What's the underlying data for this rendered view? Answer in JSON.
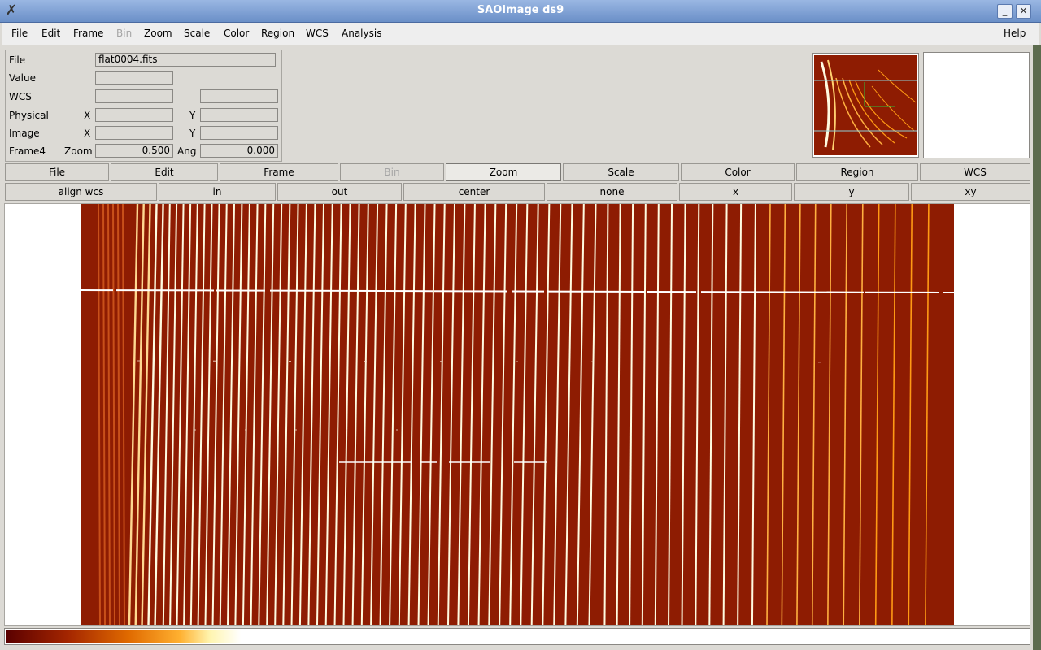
{
  "window": {
    "title": "SAOImage ds9",
    "minimize_glyph": "_",
    "close_glyph": "✕"
  },
  "menubar": {
    "items": [
      {
        "label": "File"
      },
      {
        "label": "Edit"
      },
      {
        "label": "Frame"
      },
      {
        "label": "Bin",
        "disabled": true
      },
      {
        "label": "Zoom"
      },
      {
        "label": "Scale"
      },
      {
        "label": "Color"
      },
      {
        "label": "Region"
      },
      {
        "label": "WCS"
      },
      {
        "label": "Analysis"
      }
    ],
    "help": "Help"
  },
  "info": {
    "file_label": "File",
    "file_value": "flat0004.fits",
    "value_label": "Value",
    "value": "",
    "wcs_label": "WCS",
    "wcs_value1": "",
    "wcs_value2": "",
    "physical_label": "Physical",
    "physical_x_label": "X",
    "physical_x": "",
    "physical_y_label": "Y",
    "physical_y": "",
    "image_label": "Image",
    "image_x_label": "X",
    "image_x": "",
    "image_y_label": "Y",
    "image_y": "",
    "frame_label": "Frame4",
    "zoom_label": "Zoom",
    "zoom_value": "0.500",
    "angle_label": "Ang",
    "angle_value": "0.000"
  },
  "buttonbar": {
    "major": [
      {
        "label": "File"
      },
      {
        "label": "Edit"
      },
      {
        "label": "Frame"
      },
      {
        "label": "Bin",
        "disabled": true
      },
      {
        "label": "Zoom",
        "active": true
      },
      {
        "label": "Scale"
      },
      {
        "label": "Color"
      },
      {
        "label": "Region"
      },
      {
        "label": "WCS"
      }
    ],
    "minor": [
      {
        "label": "align wcs"
      },
      {
        "label": "in"
      },
      {
        "label": "out"
      },
      {
        "label": "center"
      },
      {
        "label": "none"
      },
      {
        "label": "x"
      },
      {
        "label": "y"
      },
      {
        "label": "xy"
      }
    ]
  },
  "colors": {
    "image_background": "#8e1c02",
    "fringe_bright": "#fffbe0",
    "fringe_mid": "#ff9a14",
    "colorbar_stops": [
      "#5a0000",
      "#a32500",
      "#e06a00",
      "#ffb030",
      "#fff5b0",
      "#ffffff"
    ]
  },
  "icons": {
    "app": "x-window-icon",
    "minimize": "minimize-icon",
    "close": "close-icon"
  }
}
